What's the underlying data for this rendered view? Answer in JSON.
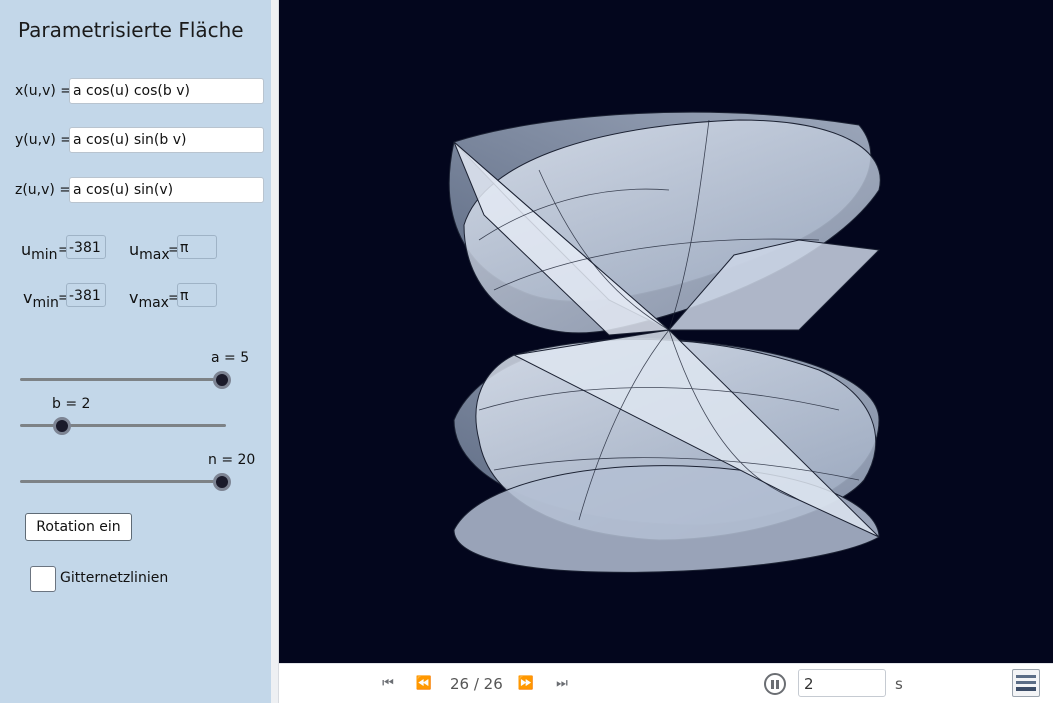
{
  "sidebar": {
    "title": "Parametrisierte Fläche",
    "equations": [
      {
        "label": "x(u,v) =",
        "value": "a cos(u) cos(b v)"
      },
      {
        "label": "y(u,v) =",
        "value": "a cos(u) sin(b v)"
      },
      {
        "label": "z(u,v) =",
        "value": "a cos(u) sin(v)"
      }
    ],
    "limits": {
      "umin": {
        "base": "u",
        "sub": "min",
        "value": "-381"
      },
      "umax": {
        "base": "u",
        "sub": "max",
        "value": "π"
      },
      "vmin": {
        "base": "v",
        "sub": "min",
        "value": "-381"
      },
      "vmax": {
        "base": "v",
        "sub": "max",
        "value": "π"
      }
    },
    "sliders": [
      {
        "label": "a = 5",
        "value": 5,
        "fraction": 1.0
      },
      {
        "label": "b = 2",
        "value": 2,
        "fraction": 0.2
      },
      {
        "label": "n = 20",
        "value": 20,
        "fraction": 1.0
      }
    ],
    "rotate_button": "Rotation ein",
    "grid_checkbox": {
      "label": "Gitternetzlinien",
      "checked": false
    }
  },
  "toolbar": {
    "frame_counter": "26 / 26",
    "speed_value": "2",
    "speed_unit": "s",
    "icons": [
      "skip-to-start-icon",
      "step-back-icon",
      "step-forward-icon",
      "skip-to-end-icon",
      "pause-icon",
      "algebra-view-icon"
    ]
  },
  "colors": {
    "sidebar_bg": "#c3d7e9",
    "viewport_bg": "#03061d",
    "surface_fill": "#c8d4e6"
  }
}
